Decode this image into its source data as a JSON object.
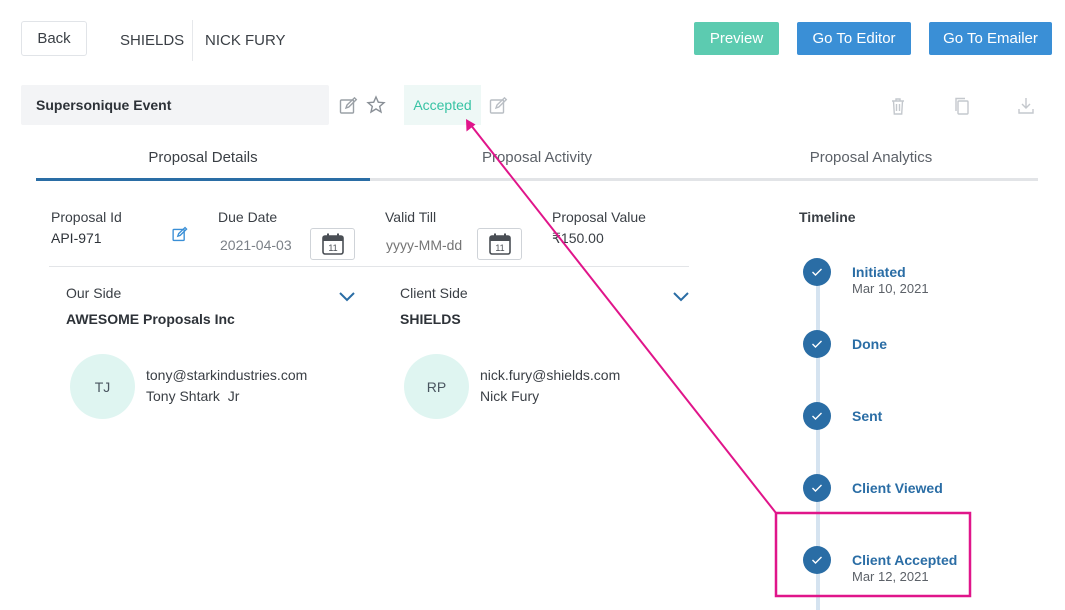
{
  "header": {
    "back_label": "Back",
    "breadcrumb": [
      "SHIELDS",
      "NICK FURY"
    ],
    "buttons": {
      "preview": "Preview",
      "go_to_editor": "Go To Editor",
      "go_to_emailer": "Go To Emailer"
    }
  },
  "proposal": {
    "title": "Supersonique Event",
    "status": "Accepted"
  },
  "tabs": [
    "Proposal Details",
    "Proposal Activity",
    "Proposal Analytics"
  ],
  "details": {
    "proposal_id_label": "Proposal Id",
    "proposal_id": "API-971",
    "due_date_label": "Due Date",
    "due_date": "2021-04-03",
    "valid_till_label": "Valid Till",
    "valid_till_placeholder": "yyyy-MM-dd",
    "proposal_value_label": "Proposal Value",
    "proposal_value": "₹150.00",
    "calendar_day": "11"
  },
  "our_side": {
    "label": "Our Side",
    "company": "AWESOME Proposals Inc",
    "initials": "TJ",
    "email": "tony@starkindustries.com",
    "name": "Tony Shtark  Jr"
  },
  "client_side": {
    "label": "Client Side",
    "company": "SHIELDS",
    "initials": "RP",
    "email": "nick.fury@shields.com",
    "name": "Nick Fury"
  },
  "timeline": {
    "title": "Timeline",
    "steps": [
      {
        "label": "Initiated",
        "date": "Mar 10, 2021"
      },
      {
        "label": "Done",
        "date": ""
      },
      {
        "label": "Sent",
        "date": ""
      },
      {
        "label": "Client Viewed",
        "date": ""
      },
      {
        "label": "Client Accepted",
        "date": "Mar 12, 2021"
      }
    ]
  },
  "colors": {
    "accent_blue": "#3a8fd6",
    "timeline_blue": "#2a6da5",
    "preview_green": "#5ccbb0",
    "accepted_green": "#37c3a4",
    "annotation_magenta": "#e0158a"
  }
}
